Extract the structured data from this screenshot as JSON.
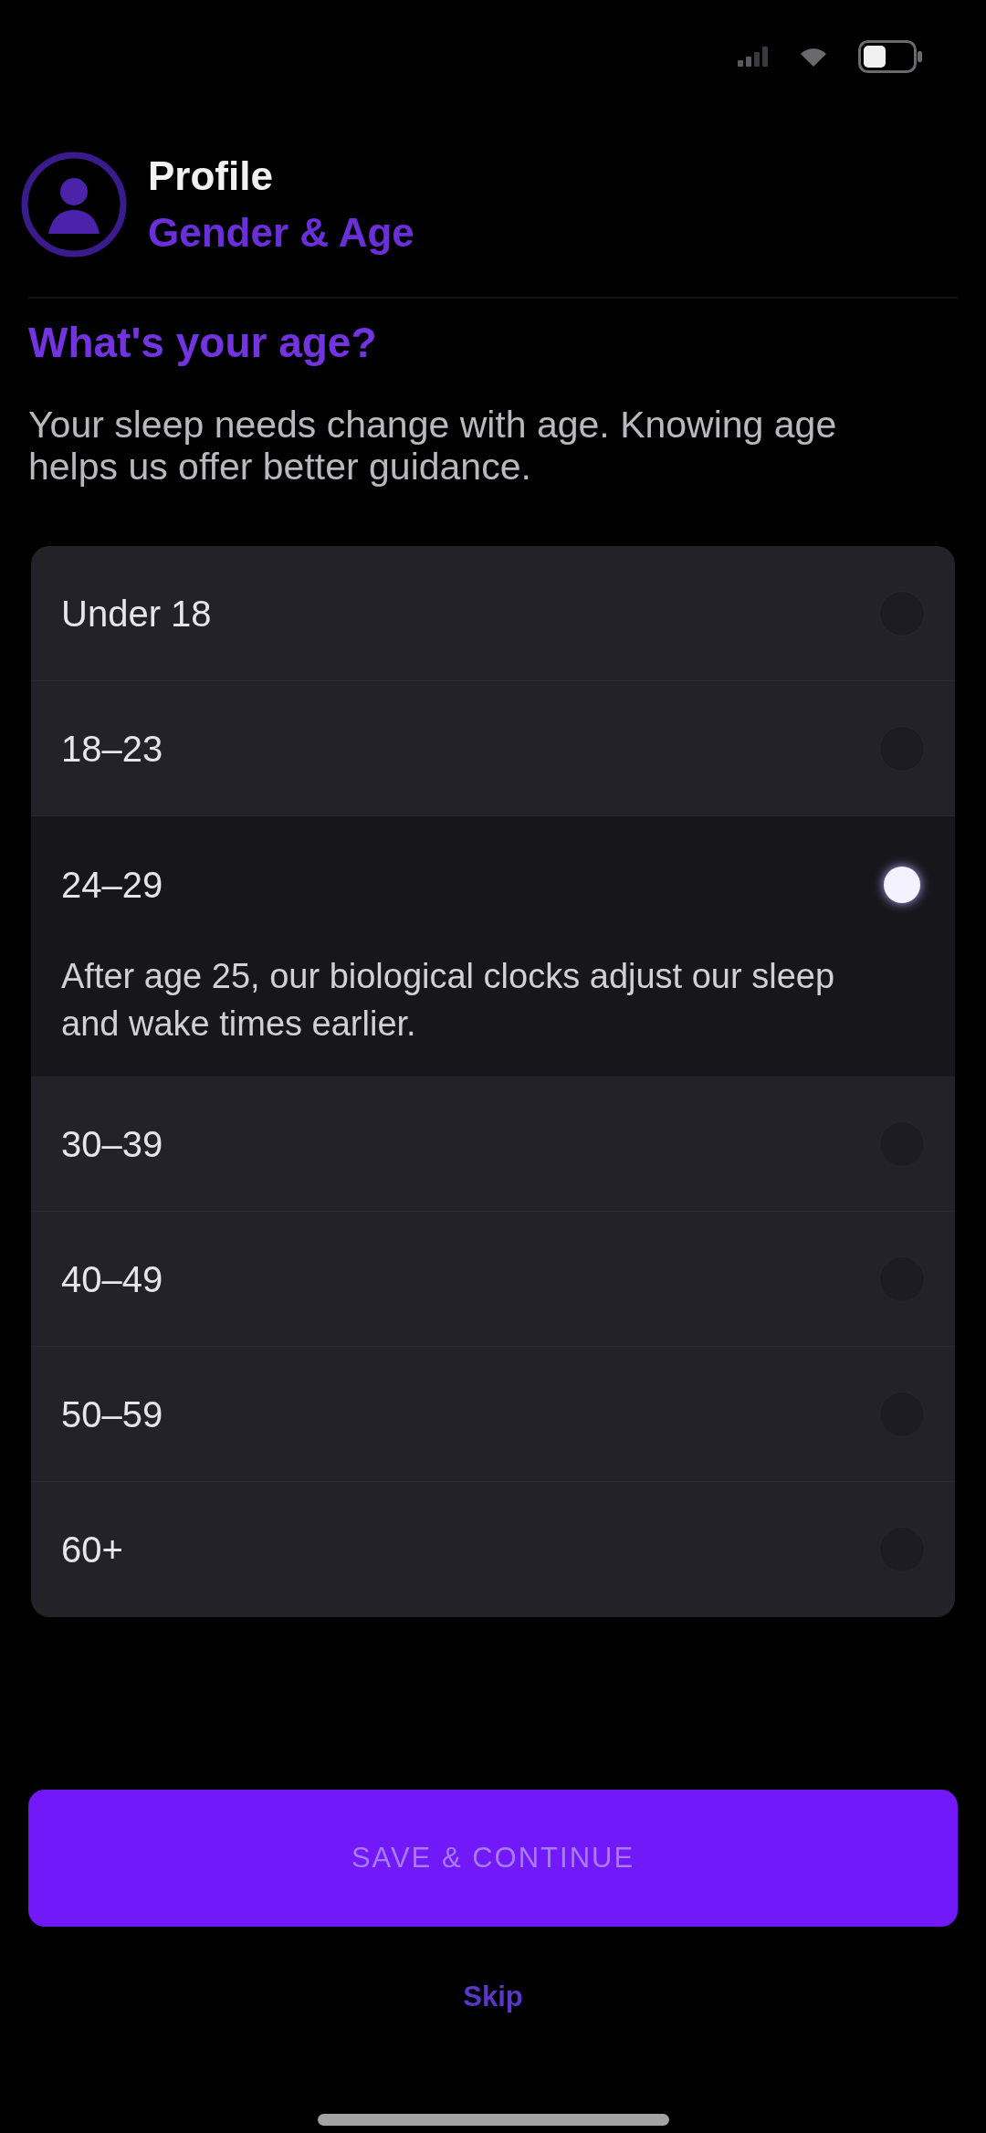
{
  "header": {
    "title": "Profile",
    "subtitle": "Gender & Age"
  },
  "question": {
    "title": "What's your age?",
    "description": "Your sleep needs change with age. Knowing age helps us offer better guidance."
  },
  "options": [
    {
      "label": "Under 18",
      "selected": false
    },
    {
      "label": "18–23",
      "selected": false
    },
    {
      "label": "24–29",
      "selected": true,
      "note": "After age 25, our biological clocks adjust our sleep and wake times earlier."
    },
    {
      "label": "30–39",
      "selected": false
    },
    {
      "label": "40–49",
      "selected": false
    },
    {
      "label": "50–59",
      "selected": false
    },
    {
      "label": "60+",
      "selected": false
    }
  ],
  "primary_button": {
    "label": "SAVE & CONTINUE"
  },
  "secondary_link": {
    "label": "Skip"
  }
}
